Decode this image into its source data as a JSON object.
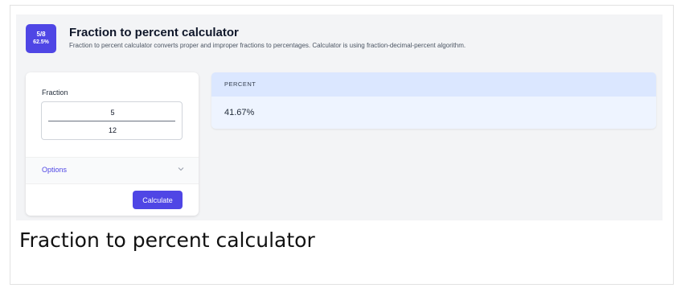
{
  "logo": {
    "top": "5/8",
    "bottom": "62.5%"
  },
  "header": {
    "title": "Fraction to percent calculator",
    "subtitle": "Fraction to percent calculator converts proper and improper fractions to percentages. Calculator is using fraction-decimal-percent algorithm."
  },
  "form": {
    "fraction_label": "Fraction",
    "numerator": "5",
    "denominator": "12",
    "options_label": "Options",
    "options_icon": "chevron-down-icon",
    "calculate_label": "Calculate"
  },
  "result": {
    "header": "PERCENT",
    "value": "41.67%"
  },
  "caption": "Fraction to percent calculator",
  "colors": {
    "accent": "#4f46e5",
    "app_background": "#f3f4f6",
    "result_header": "#dbe7ff",
    "result_body": "#eef4ff"
  }
}
